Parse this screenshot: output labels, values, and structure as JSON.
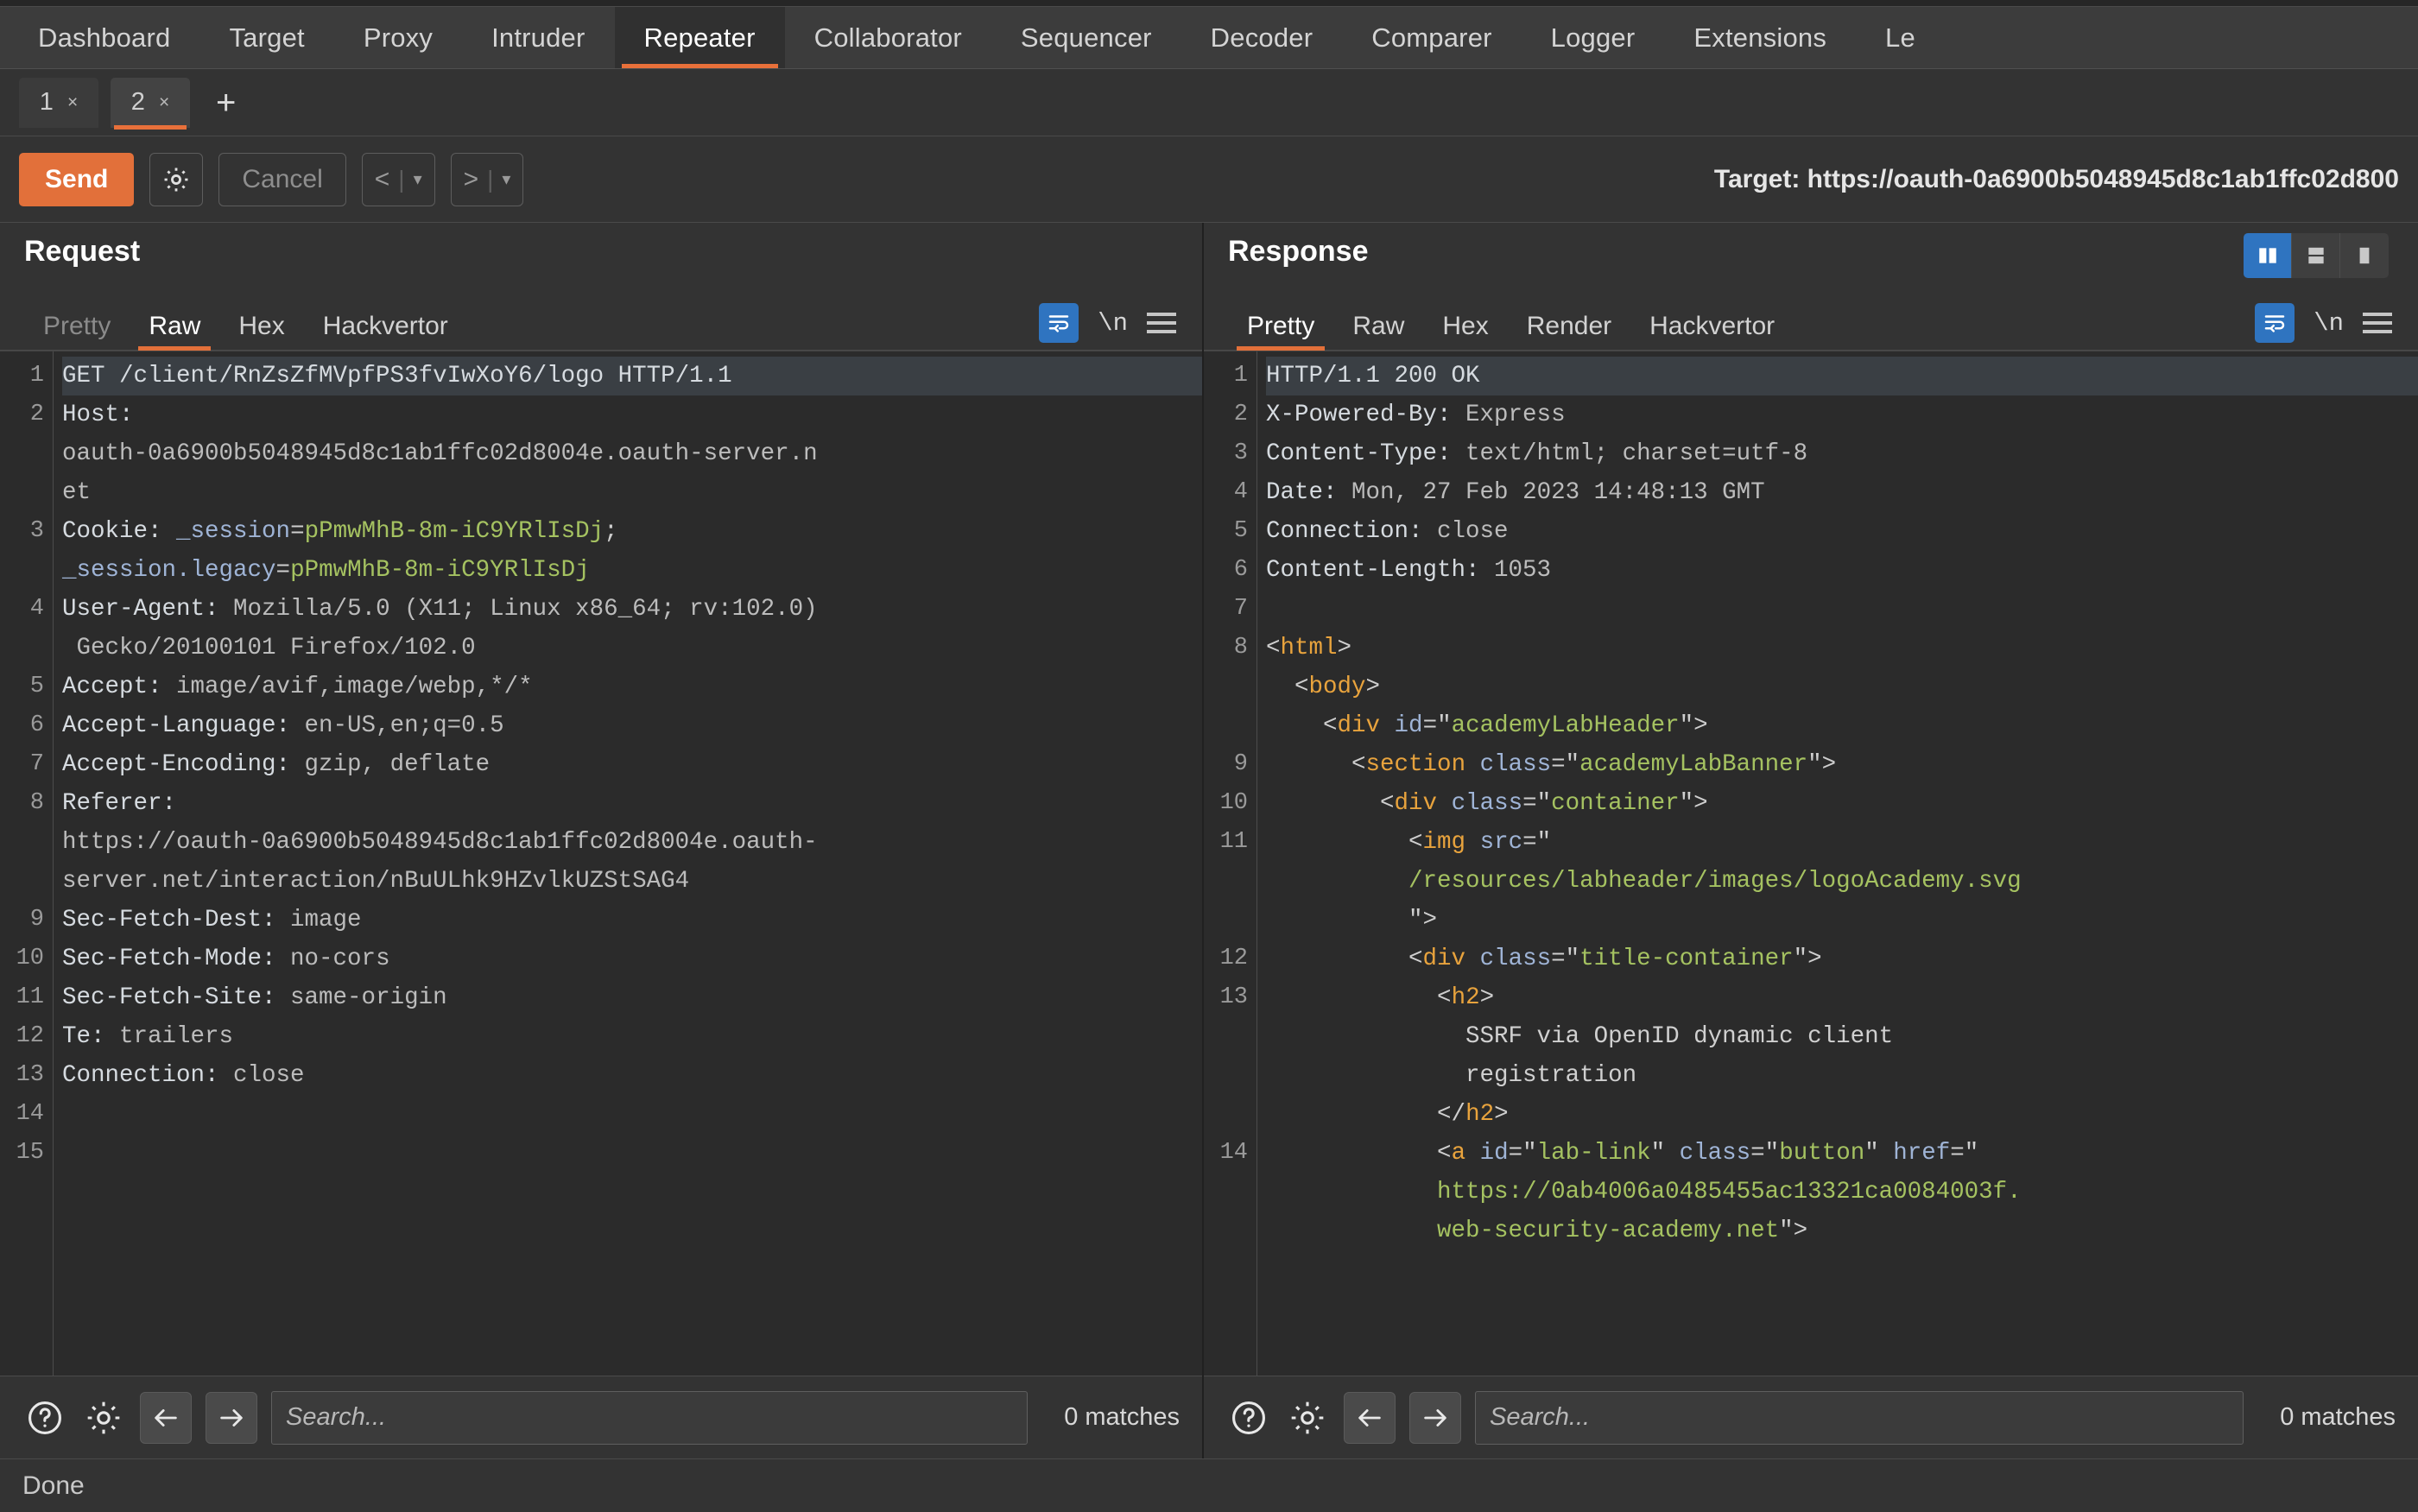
{
  "window": {
    "main_tabs": [
      {
        "label": "Dashboard",
        "active": false
      },
      {
        "label": "Target",
        "active": false
      },
      {
        "label": "Proxy",
        "active": false
      },
      {
        "label": "Intruder",
        "active": false
      },
      {
        "label": "Repeater",
        "active": true
      },
      {
        "label": "Collaborator",
        "active": false
      },
      {
        "label": "Sequencer",
        "active": false
      },
      {
        "label": "Decoder",
        "active": false
      },
      {
        "label": "Comparer",
        "active": false
      },
      {
        "label": "Logger",
        "active": false
      },
      {
        "label": "Extensions",
        "active": false
      },
      {
        "label": "Le",
        "active": false
      }
    ]
  },
  "repeater_tabs": {
    "items": [
      {
        "label": "1",
        "close": "×",
        "active": false
      },
      {
        "label": "2",
        "close": "×",
        "active": true
      }
    ],
    "add_label": "+"
  },
  "toolbar": {
    "send_label": "Send",
    "settings_icon": "gear-icon",
    "cancel_label": "Cancel",
    "prev_label": "<",
    "prev_caret": "▾",
    "next_label": ">",
    "next_caret": "▾",
    "separator": "|",
    "target_label": "Target: https://oauth-0a6900b5048945d8c1ab1ffc02d800"
  },
  "request": {
    "title": "Request",
    "tabs": [
      {
        "label": "Pretty",
        "active": false,
        "dim": true
      },
      {
        "label": "Raw",
        "active": true,
        "dim": false
      },
      {
        "label": "Hex",
        "active": false,
        "dim": false
      },
      {
        "label": "Hackvertor",
        "active": false,
        "dim": false
      }
    ],
    "tools": {
      "wrap_icon": "word-wrap-icon",
      "newline_label": "\\n",
      "menu_icon": "hamburger-menu-icon"
    },
    "line_numbers": [
      "1",
      "2",
      "",
      "",
      "3",
      "",
      "4",
      "",
      "5",
      "6",
      "7",
      "8",
      "",
      "",
      "9",
      "10",
      "11",
      "12",
      "13",
      "14",
      "15"
    ],
    "lines": [
      {
        "n": "1",
        "highlight": true,
        "segments": [
          {
            "t": "GET /client/RnZsZfMVpfPS3fvIwXoY6/logo HTTP/1.1",
            "c": "tok-hdr"
          }
        ]
      },
      {
        "n": "2",
        "highlight": false,
        "segments": [
          {
            "t": "Host: ",
            "c": "tok-hdr"
          }
        ]
      },
      {
        "n": "",
        "highlight": false,
        "segments": [
          {
            "t": "oauth-0a6900b5048945d8c1ab1ffc02d8004e.oauth-server.n",
            "c": "tok-val"
          }
        ]
      },
      {
        "n": "",
        "highlight": false,
        "segments": [
          {
            "t": "et",
            "c": "tok-val"
          }
        ]
      },
      {
        "n": "3",
        "highlight": false,
        "segments": [
          {
            "t": "Cookie: ",
            "c": "tok-hdr"
          },
          {
            "t": "_session",
            "c": "tok-name"
          },
          {
            "t": "=",
            "c": "tok-punct"
          },
          {
            "t": "pPmwMhB-8m-iC9YRlIsDj",
            "c": "tok-green"
          },
          {
            "t": ";",
            "c": "tok-punct"
          }
        ]
      },
      {
        "n": "",
        "highlight": false,
        "segments": [
          {
            "t": "_session.legacy",
            "c": "tok-name"
          },
          {
            "t": "=",
            "c": "tok-punct"
          },
          {
            "t": "pPmwMhB-8m-iC9YRlIsDj",
            "c": "tok-green"
          }
        ]
      },
      {
        "n": "4",
        "highlight": false,
        "segments": [
          {
            "t": "User-Agent: ",
            "c": "tok-hdr"
          },
          {
            "t": "Mozilla/5.0 (X11; Linux x86_64; rv:102.0)",
            "c": "tok-val"
          }
        ]
      },
      {
        "n": "",
        "highlight": false,
        "segments": [
          {
            "t": " Gecko/20100101 Firefox/102.0",
            "c": "tok-val"
          }
        ]
      },
      {
        "n": "5",
        "highlight": false,
        "segments": [
          {
            "t": "Accept: ",
            "c": "tok-hdr"
          },
          {
            "t": "image/avif,image/webp,*/*",
            "c": "tok-val"
          }
        ]
      },
      {
        "n": "6",
        "highlight": false,
        "segments": [
          {
            "t": "Accept-Language: ",
            "c": "tok-hdr"
          },
          {
            "t": "en-US,en;q=0.5",
            "c": "tok-val"
          }
        ]
      },
      {
        "n": "7",
        "highlight": false,
        "segments": [
          {
            "t": "Accept-Encoding: ",
            "c": "tok-hdr"
          },
          {
            "t": "gzip, deflate",
            "c": "tok-val"
          }
        ]
      },
      {
        "n": "8",
        "highlight": false,
        "segments": [
          {
            "t": "Referer: ",
            "c": "tok-hdr"
          }
        ]
      },
      {
        "n": "",
        "highlight": false,
        "segments": [
          {
            "t": "https://oauth-0a6900b5048945d8c1ab1ffc02d8004e.oauth-",
            "c": "tok-val"
          }
        ]
      },
      {
        "n": "",
        "highlight": false,
        "segments": [
          {
            "t": "server.net/interaction/nBuULhk9HZvlkUZStSAG4",
            "c": "tok-val"
          }
        ]
      },
      {
        "n": "9",
        "highlight": false,
        "segments": [
          {
            "t": "Sec-Fetch-Dest: ",
            "c": "tok-hdr"
          },
          {
            "t": "image",
            "c": "tok-val"
          }
        ]
      },
      {
        "n": "10",
        "highlight": false,
        "segments": [
          {
            "t": "Sec-Fetch-Mode: ",
            "c": "tok-hdr"
          },
          {
            "t": "no-cors",
            "c": "tok-val"
          }
        ]
      },
      {
        "n": "11",
        "highlight": false,
        "segments": [
          {
            "t": "Sec-Fetch-Site: ",
            "c": "tok-hdr"
          },
          {
            "t": "same-origin",
            "c": "tok-val"
          }
        ]
      },
      {
        "n": "12",
        "highlight": false,
        "segments": [
          {
            "t": "Te: ",
            "c": "tok-hdr"
          },
          {
            "t": "trailers",
            "c": "tok-val"
          }
        ]
      },
      {
        "n": "13",
        "highlight": false,
        "segments": [
          {
            "t": "Connection: ",
            "c": "tok-hdr"
          },
          {
            "t": "close",
            "c": "tok-val"
          }
        ]
      },
      {
        "n": "14",
        "highlight": false,
        "segments": [
          {
            "t": "",
            "c": "tok-val"
          }
        ]
      },
      {
        "n": "15",
        "highlight": false,
        "segments": [
          {
            "t": "",
            "c": "tok-val"
          }
        ]
      }
    ],
    "search": {
      "help_icon": "help-icon",
      "settings_icon": "gear-icon",
      "prev_icon": "arrow-left-icon",
      "next_icon": "arrow-right-icon",
      "placeholder": "Search...",
      "value": "",
      "matches": "0 matches"
    }
  },
  "response": {
    "title": "Response",
    "layout_toggle": [
      {
        "name": "side-by-side-layout",
        "active": true
      },
      {
        "name": "stacked-layout",
        "active": false
      },
      {
        "name": "single-layout",
        "active": false
      }
    ],
    "tabs": [
      {
        "label": "Pretty",
        "active": true,
        "dim": false
      },
      {
        "label": "Raw",
        "active": false,
        "dim": false
      },
      {
        "label": "Hex",
        "active": false,
        "dim": false
      },
      {
        "label": "Render",
        "active": false,
        "dim": false
      },
      {
        "label": "Hackvertor",
        "active": false,
        "dim": false
      }
    ],
    "tools": {
      "wrap_icon": "word-wrap-icon",
      "newline_label": "\\n",
      "menu_icon": "hamburger-menu-icon"
    },
    "lines": [
      {
        "n": "1",
        "highlight": true,
        "segments": [
          {
            "t": "HTTP/1.1 200 OK",
            "c": "tok-hdr"
          }
        ]
      },
      {
        "n": "2",
        "highlight": false,
        "segments": [
          {
            "t": "X-Powered-By: ",
            "c": "tok-hdr"
          },
          {
            "t": "Express",
            "c": "tok-val"
          }
        ]
      },
      {
        "n": "3",
        "highlight": false,
        "segments": [
          {
            "t": "Content-Type: ",
            "c": "tok-hdr"
          },
          {
            "t": "text/html; charset=utf-8",
            "c": "tok-val"
          }
        ]
      },
      {
        "n": "4",
        "highlight": false,
        "segments": [
          {
            "t": "Date: ",
            "c": "tok-hdr"
          },
          {
            "t": "Mon, 27 Feb 2023 14:48:13 GMT",
            "c": "tok-val"
          }
        ]
      },
      {
        "n": "5",
        "highlight": false,
        "segments": [
          {
            "t": "Connection: ",
            "c": "tok-hdr"
          },
          {
            "t": "close",
            "c": "tok-val"
          }
        ]
      },
      {
        "n": "6",
        "highlight": false,
        "segments": [
          {
            "t": "Content-Length: ",
            "c": "tok-hdr"
          },
          {
            "t": "1053",
            "c": "tok-val"
          }
        ]
      },
      {
        "n": "7",
        "highlight": false,
        "segments": [
          {
            "t": "",
            "c": "tok-val"
          }
        ]
      },
      {
        "n": "8",
        "highlight": false,
        "segments": [
          {
            "t": "<",
            "c": "tok-punct"
          },
          {
            "t": "html",
            "c": "tok-tag"
          },
          {
            "t": ">",
            "c": "tok-punct"
          }
        ]
      },
      {
        "n": "",
        "highlight": false,
        "segments": [
          {
            "t": "  <",
            "c": "tok-punct"
          },
          {
            "t": "body",
            "c": "tok-tag"
          },
          {
            "t": ">",
            "c": "tok-punct"
          }
        ]
      },
      {
        "n": "",
        "highlight": false,
        "segments": [
          {
            "t": "    <",
            "c": "tok-punct"
          },
          {
            "t": "div ",
            "c": "tok-tag"
          },
          {
            "t": "id",
            "c": "tok-attr"
          },
          {
            "t": "=\"",
            "c": "tok-punct"
          },
          {
            "t": "academyLabHeader",
            "c": "tok-green"
          },
          {
            "t": "\">",
            "c": "tok-punct"
          }
        ]
      },
      {
        "n": "9",
        "highlight": false,
        "segments": [
          {
            "t": "      <",
            "c": "tok-punct"
          },
          {
            "t": "section ",
            "c": "tok-tag"
          },
          {
            "t": "class",
            "c": "tok-attr"
          },
          {
            "t": "=\"",
            "c": "tok-punct"
          },
          {
            "t": "academyLabBanner",
            "c": "tok-green"
          },
          {
            "t": "\">",
            "c": "tok-punct"
          }
        ]
      },
      {
        "n": "10",
        "highlight": false,
        "segments": [
          {
            "t": "        <",
            "c": "tok-punct"
          },
          {
            "t": "div ",
            "c": "tok-tag"
          },
          {
            "t": "class",
            "c": "tok-attr"
          },
          {
            "t": "=\"",
            "c": "tok-punct"
          },
          {
            "t": "container",
            "c": "tok-green"
          },
          {
            "t": "\">",
            "c": "tok-punct"
          }
        ]
      },
      {
        "n": "11",
        "highlight": false,
        "segments": [
          {
            "t": "          <",
            "c": "tok-punct"
          },
          {
            "t": "img ",
            "c": "tok-tag"
          },
          {
            "t": "src",
            "c": "tok-attr"
          },
          {
            "t": "=\"",
            "c": "tok-punct"
          }
        ]
      },
      {
        "n": "",
        "highlight": false,
        "segments": [
          {
            "t": "          /resources/labheader/images/logoAcademy.svg",
            "c": "tok-green"
          }
        ]
      },
      {
        "n": "",
        "highlight": false,
        "segments": [
          {
            "t": "          \">",
            "c": "tok-punct"
          }
        ]
      },
      {
        "n": "12",
        "highlight": false,
        "segments": [
          {
            "t": "          <",
            "c": "tok-punct"
          },
          {
            "t": "div ",
            "c": "tok-tag"
          },
          {
            "t": "class",
            "c": "tok-attr"
          },
          {
            "t": "=\"",
            "c": "tok-punct"
          },
          {
            "t": "title-container",
            "c": "tok-green"
          },
          {
            "t": "\">",
            "c": "tok-punct"
          }
        ]
      },
      {
        "n": "13",
        "highlight": false,
        "segments": [
          {
            "t": "            <",
            "c": "tok-punct"
          },
          {
            "t": "h2",
            "c": "tok-tag"
          },
          {
            "t": ">",
            "c": "tok-punct"
          }
        ]
      },
      {
        "n": "",
        "highlight": false,
        "segments": [
          {
            "t": "              SSRF via OpenID dynamic client",
            "c": "tok-txt"
          }
        ]
      },
      {
        "n": "",
        "highlight": false,
        "segments": [
          {
            "t": "              registration",
            "c": "tok-txt"
          }
        ]
      },
      {
        "n": "",
        "highlight": false,
        "segments": [
          {
            "t": "            </",
            "c": "tok-punct"
          },
          {
            "t": "h2",
            "c": "tok-tag"
          },
          {
            "t": ">",
            "c": "tok-punct"
          }
        ]
      },
      {
        "n": "14",
        "highlight": false,
        "segments": [
          {
            "t": "            <",
            "c": "tok-punct"
          },
          {
            "t": "a ",
            "c": "tok-tag"
          },
          {
            "t": "id",
            "c": "tok-attr"
          },
          {
            "t": "=\"",
            "c": "tok-punct"
          },
          {
            "t": "lab-link",
            "c": "tok-green"
          },
          {
            "t": "\" ",
            "c": "tok-punct"
          },
          {
            "t": "class",
            "c": "tok-attr"
          },
          {
            "t": "=\"",
            "c": "tok-punct"
          },
          {
            "t": "button",
            "c": "tok-green"
          },
          {
            "t": "\" ",
            "c": "tok-punct"
          },
          {
            "t": "href",
            "c": "tok-attr"
          },
          {
            "t": "=\"",
            "c": "tok-punct"
          }
        ]
      },
      {
        "n": "",
        "highlight": false,
        "segments": [
          {
            "t": "            https://0ab4006a0485455ac13321ca0084003f.",
            "c": "tok-green"
          }
        ]
      },
      {
        "n": "",
        "highlight": false,
        "segments": [
          {
            "t": "            web-security-academy.net",
            "c": "tok-green"
          },
          {
            "t": "\">",
            "c": "tok-punct"
          }
        ]
      }
    ],
    "search": {
      "help_icon": "help-icon",
      "settings_icon": "gear-icon",
      "prev_icon": "arrow-left-icon",
      "next_icon": "arrow-right-icon",
      "placeholder": "Search...",
      "value": "",
      "matches": "0 matches"
    }
  },
  "statusbar": {
    "text": "Done"
  },
  "colors": {
    "accent_orange": "#e2703a",
    "accent_blue": "#2f74c0",
    "bg": "#333333",
    "editor_bg": "#2b2b2b",
    "string_green": "#a5c261",
    "tag_gold": "#e8a33d"
  }
}
